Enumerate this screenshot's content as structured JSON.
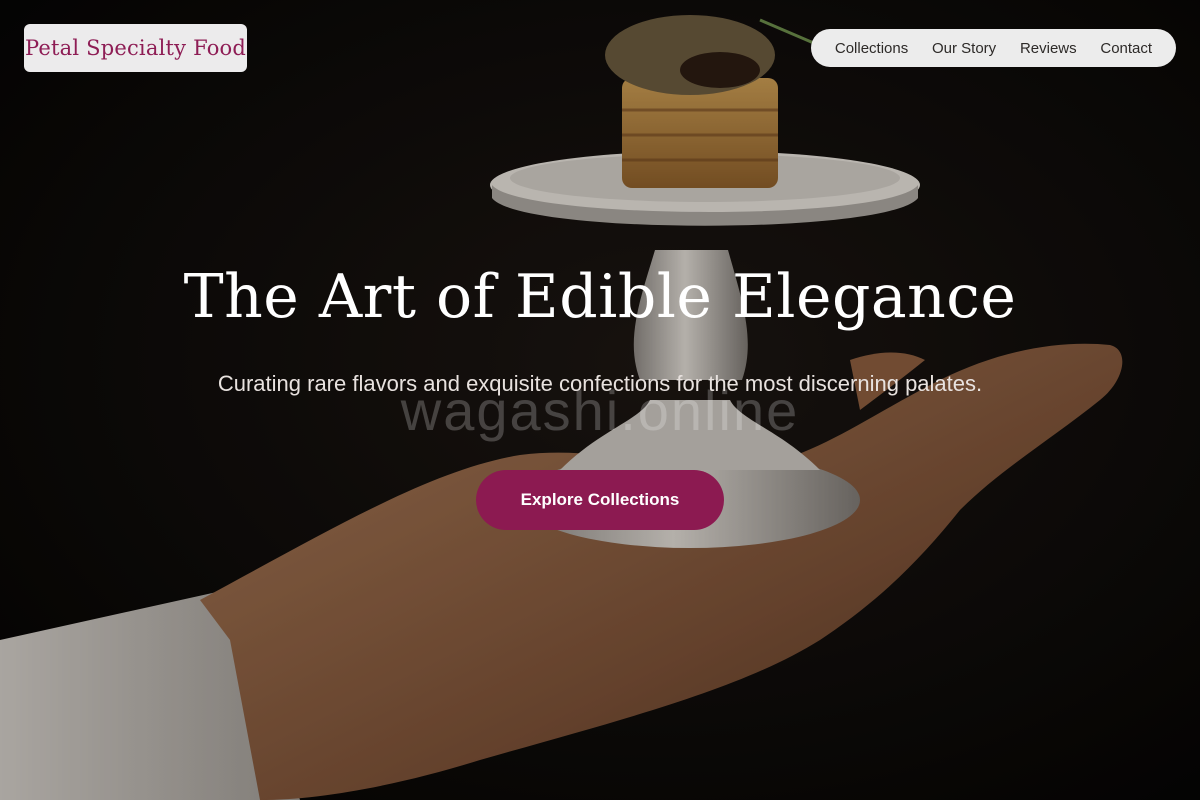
{
  "brand": {
    "name": "Petal Specialty Food",
    "accent_color": "#8c1a51"
  },
  "nav": {
    "items": [
      {
        "label": "Collections"
      },
      {
        "label": "Our Story"
      },
      {
        "label": "Reviews"
      },
      {
        "label": "Contact"
      }
    ]
  },
  "hero": {
    "title": "The Art of Edible Elegance",
    "subtitle": "Curating rare flavors and exquisite confections for the most discerning palates.",
    "watermark": "wagashi.online",
    "cta_label": "Explore Collections",
    "image_description_icon": "plated-dessert-on-hand-photo"
  }
}
